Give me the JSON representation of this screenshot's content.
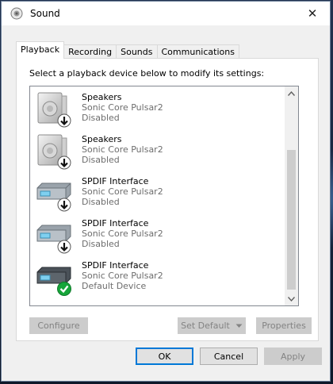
{
  "window": {
    "title": "Sound",
    "close_glyph": "✕"
  },
  "tabs": [
    {
      "label": "Playback",
      "active": true
    },
    {
      "label": "Recording",
      "active": false
    },
    {
      "label": "Sounds",
      "active": false
    },
    {
      "label": "Communications",
      "active": false
    }
  ],
  "playback": {
    "instruction": "Select a playback device below to modify its settings:",
    "devices": [
      {
        "name": "Speakers",
        "driver": "Sonic Core Pulsar2",
        "status": "Disabled",
        "icon": "speaker-icon",
        "badge": "down-arrow-badge"
      },
      {
        "name": "Speakers",
        "driver": "Sonic Core Pulsar2",
        "status": "Disabled",
        "icon": "speaker-icon",
        "badge": "down-arrow-badge"
      },
      {
        "name": "SPDIF Interface",
        "driver": "Sonic Core Pulsar2",
        "status": "Disabled",
        "icon": "spdif-device-icon",
        "badge": "down-arrow-badge"
      },
      {
        "name": "SPDIF Interface",
        "driver": "Sonic Core Pulsar2",
        "status": "Disabled",
        "icon": "spdif-device-icon",
        "badge": "down-arrow-badge"
      },
      {
        "name": "SPDIF Interface",
        "driver": "Sonic Core Pulsar2",
        "status": "Default Device",
        "icon": "spdif-device-icon",
        "badge": "green-check-badge"
      }
    ],
    "configure_label": "Configure",
    "set_default_label": "Set Default",
    "properties_label": "Properties"
  },
  "footer": {
    "ok_label": "OK",
    "cancel_label": "Cancel",
    "apply_label": "Apply"
  },
  "colors": {
    "accent": "#0078d7",
    "check_green": "#16a53a"
  }
}
